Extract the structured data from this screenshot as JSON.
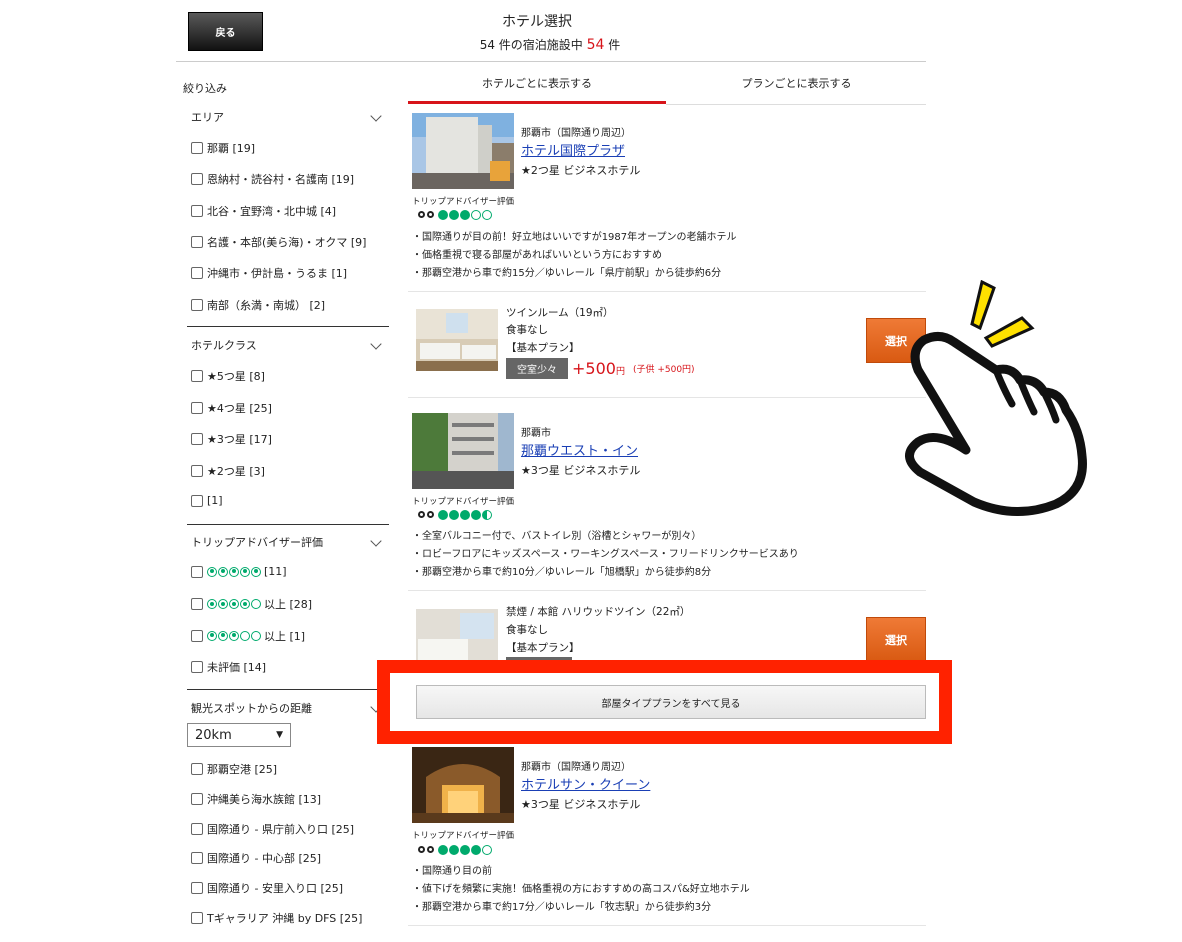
{
  "header": {
    "back_label": "戻る",
    "title": "ホテル選択",
    "count_prefix": "54 件の宿泊施設中",
    "count_value": "54",
    "count_suffix": "件"
  },
  "sidebar": {
    "heading": "絞り込み",
    "area": {
      "title": "エリア",
      "items": [
        "那覇 [19]",
        "恩納村・読谷村・名護南 [19]",
        "北谷・宜野湾・北中城 [4]",
        "名護・本部(美ら海)・オクマ [9]",
        "沖縄市・伊計島・うるま [1]",
        "南部（糸満・南城） [2]"
      ]
    },
    "hotel_class": {
      "title": "ホテルクラス",
      "items": [
        "★5つ星 [8]",
        "★4つ星 [25]",
        "★3つ星 [17]",
        "★2つ星 [3]",
        " [1]"
      ]
    },
    "tripadvisor": {
      "title": "トリップアドバイザー評価",
      "items": [
        {
          "rating": 5,
          "label": " [11]"
        },
        {
          "rating": 4,
          "label": "以上 [28]"
        },
        {
          "rating": 3,
          "label": "以上 [1]"
        },
        {
          "rating": 0,
          "label": "未評価 [14]"
        }
      ]
    },
    "distance": {
      "title": "観光スポットからの距離",
      "selected": "20km",
      "items": [
        "那覇空港 [25]",
        "沖縄美ら海水族館 [13]",
        "国際通り - 県庁前入り口 [25]",
        "国際通り - 中心部 [25]",
        "国際通り - 安里入り口 [25]",
        "Tギャラリア 沖縄 by DFS [25]"
      ]
    }
  },
  "tabs": [
    "ホテルごとに表示する",
    "プランごとに表示する"
  ],
  "ta_label": "トリップアドバイザー評価",
  "hotels": [
    {
      "area": "那覇市（国際通り周辺）",
      "name": "ホテル国際プラザ",
      "class": "★2つ星 ビジネスホテル",
      "rating": 3,
      "features": [
        "・国際通りが目の前！好立地はいいですが1987年オープンの老舗ホテル",
        "・価格重視で寝る部屋があればいいという方におすすめ",
        "・那覇空港から車で約15分／ゆいレール「県庁前駅」から徒歩約6分"
      ],
      "plan": {
        "room": "ツインルーム（19㎡）",
        "meal": "食事なし",
        "plan": "【基本プラン】",
        "vacancy": "空室少々",
        "price": "+500",
        "yen": "円",
        "child": "(子供 +500円)"
      }
    },
    {
      "area": "那覇市",
      "name": "那覇ウエスト・イン",
      "class": "★3つ星 ビジネスホテル",
      "rating": 4.5,
      "features": [
        "・全室バルコニー付で、バストイレ別（浴槽とシャワーが別々）",
        "・ロビーフロアにキッズスペース・ワーキングスペース・フリードリンクサービスあり",
        "・那覇空港から車で約10分／ゆいレール「旭橋駅」から徒歩約8分"
      ],
      "plan": {
        "room": "禁煙 / 本館 ハリウッドツイン（22㎡）",
        "meal": "食事なし",
        "plan": "【基本プラン】"
      }
    },
    {
      "area": "那覇市（国際通り周辺）",
      "name": "ホテルサン・クイーン",
      "class": "★3つ星 ビジネスホテル",
      "rating": 4,
      "features": [
        "・国際通り目の前",
        "・値下げを頻繁に実施！価格重視の方におすすめの高コスパ&好立地ホテル",
        "・那覇空港から車で約17分／ゆいレール「牧志駅」から徒歩約3分"
      ]
    }
  ],
  "select_label": "選択",
  "see_all_label": "部屋タイププランをすべて見る",
  "colors": {
    "accent_red": "#d7141a",
    "select_orange": "#e8691e",
    "highlight_red": "#ff2200",
    "ta_green": "#00aa6c"
  }
}
